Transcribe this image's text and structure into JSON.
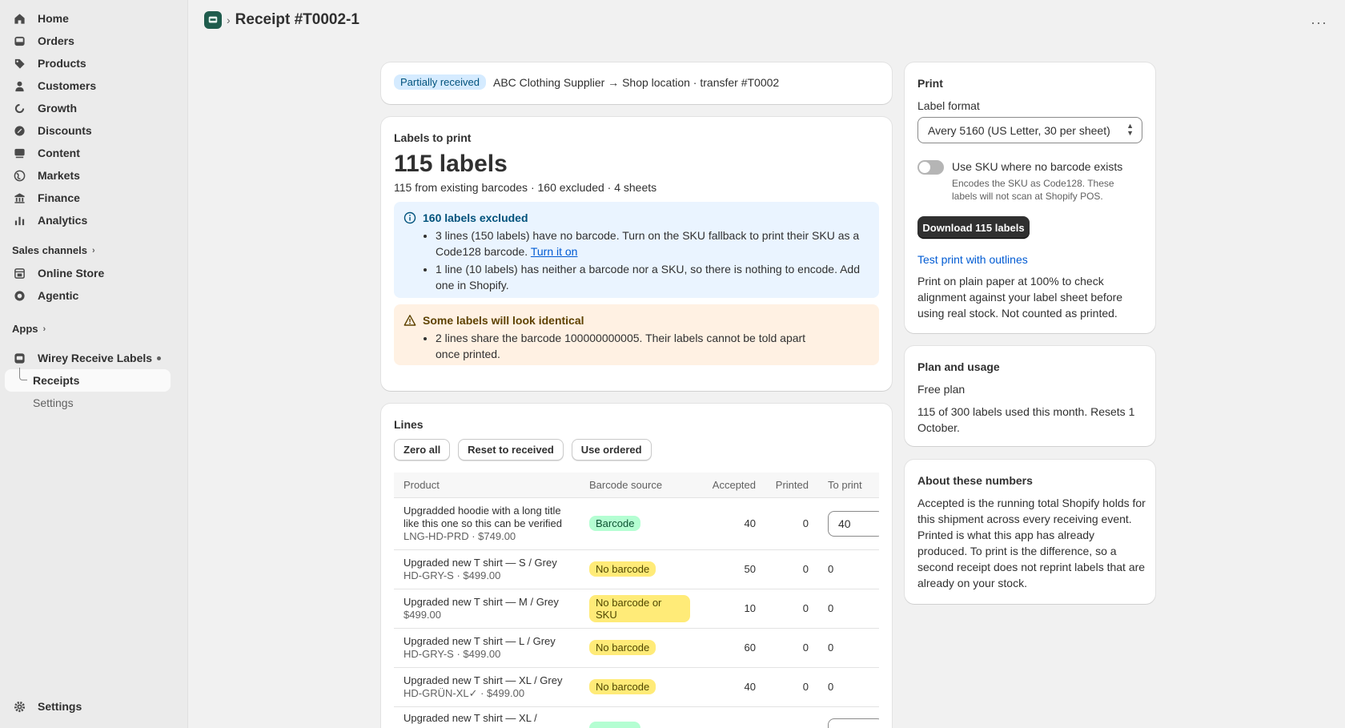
{
  "sidebar": {
    "items": [
      {
        "label": "Home",
        "icon": "home-icon"
      },
      {
        "label": "Orders",
        "icon": "inbox-icon"
      },
      {
        "label": "Products",
        "icon": "tag-icon"
      },
      {
        "label": "Customers",
        "icon": "person-icon"
      },
      {
        "label": "Growth",
        "icon": "growth-icon"
      },
      {
        "label": "Discounts",
        "icon": "discount-icon"
      },
      {
        "label": "Content",
        "icon": "content-icon"
      },
      {
        "label": "Markets",
        "icon": "globe-icon"
      },
      {
        "label": "Finance",
        "icon": "bank-icon"
      },
      {
        "label": "Analytics",
        "icon": "bar-chart-icon"
      }
    ],
    "sales_channels_label": "Sales channels",
    "channels": [
      {
        "label": "Online Store",
        "icon": "store-icon"
      },
      {
        "label": "Agentic",
        "icon": "agentic-icon"
      }
    ],
    "apps_label": "Apps",
    "app": {
      "label": "Wirey Receive Labels",
      "icon": "app-icon"
    },
    "app_subitems": [
      {
        "label": "Receipts"
      },
      {
        "label": "Settings"
      }
    ],
    "footer_settings": "Settings"
  },
  "header": {
    "title": "Receipt #T0002-1"
  },
  "status_card": {
    "badge": "Partially received",
    "text": "ABC Clothing Supplier → Shop location · transfer #T0002"
  },
  "labels_card": {
    "heading": "Labels to print",
    "count": "115 labels",
    "summary": "115 from existing barcodes · 160 excluded · 4 sheets",
    "info_banner": {
      "title": "160 labels excluded",
      "item1": "3 lines (150 labels) have no barcode. Turn on the SKU fallback to print their SKU as a Code128 barcode.",
      "item1_link": "Turn it on",
      "item2": "1 line (10 labels) has neither a barcode nor a SKU, so there is nothing to encode. Add one in Shopify."
    },
    "warning_banner": {
      "title": "Some labels will look identical",
      "item1": "2 lines share the barcode 100000000005. Their labels cannot be told apart once printed."
    }
  },
  "lines_card": {
    "heading": "Lines",
    "buttons": [
      "Zero all",
      "Reset to received",
      "Use ordered"
    ],
    "columns": [
      "Product",
      "Barcode source",
      "Accepted",
      "Printed",
      "To print"
    ],
    "rows": [
      {
        "title": "Upgradded hoodie with a long title like this one so this can be verified",
        "meta": "LNG-HD-PRD · $749.00",
        "source": "Barcode",
        "tone": "green",
        "accepted": "40",
        "printed": "0",
        "to_print": "40",
        "editable": true
      },
      {
        "title": "Upgraded new T shirt — S / Grey",
        "meta": "HD-GRY-S · $499.00",
        "source": "No barcode",
        "tone": "yellow",
        "accepted": "50",
        "printed": "0",
        "to_print": "0",
        "editable": false
      },
      {
        "title": "Upgraded new T shirt — M / Grey",
        "meta": "$499.00",
        "source": "No barcode or SKU",
        "tone": "yellow",
        "accepted": "10",
        "printed": "0",
        "to_print": "0",
        "editable": false
      },
      {
        "title": "Upgraded new T shirt — L / Grey",
        "meta": "HD-GRY-S · $499.00",
        "source": "No barcode",
        "tone": "yellow",
        "accepted": "60",
        "printed": "0",
        "to_print": "0",
        "editable": false
      },
      {
        "title": "Upgraded new T shirt — XL / Grey",
        "meta": "HD-GRÜN-XL✓ · $499.00",
        "source": "No barcode",
        "tone": "yellow",
        "accepted": "40",
        "printed": "0",
        "to_print": "0",
        "editable": false
      },
      {
        "title": "Upgraded new T shirt — XL /",
        "meta": "",
        "source": "",
        "tone": "green",
        "accepted": "",
        "printed": "",
        "to_print": "",
        "editable": true
      }
    ]
  },
  "print_card": {
    "heading": "Print",
    "format_label": "Label format",
    "format_value": "Avery 5160 (US Letter, 30 per sheet)",
    "toggle_label": "Use SKU where no barcode exists",
    "toggle_help": "Encodes the SKU as Code128. These labels will not scan at Shopify POS.",
    "download_label": "Download 115 labels",
    "test_link": "Test print with outlines",
    "test_help": "Print on plain paper at 100% to check alignment against your label sheet before using real stock. Not counted as printed."
  },
  "plan_card": {
    "heading": "Plan and usage",
    "plan": "Free plan",
    "usage": "115 of 300 labels used this month. Resets 1 October."
  },
  "about_card": {
    "heading": "About these numbers",
    "text": "Accepted is the running total Shopify holds for this shipment across every receiving event. Printed is what this app has already produced. To print is the difference, so a second receipt does not reprint labels that are already on your stock."
  },
  "colors": {
    "accent": "#005bd3",
    "info_bg": "#eaf4ff",
    "warning_bg": "#fff1e3"
  }
}
